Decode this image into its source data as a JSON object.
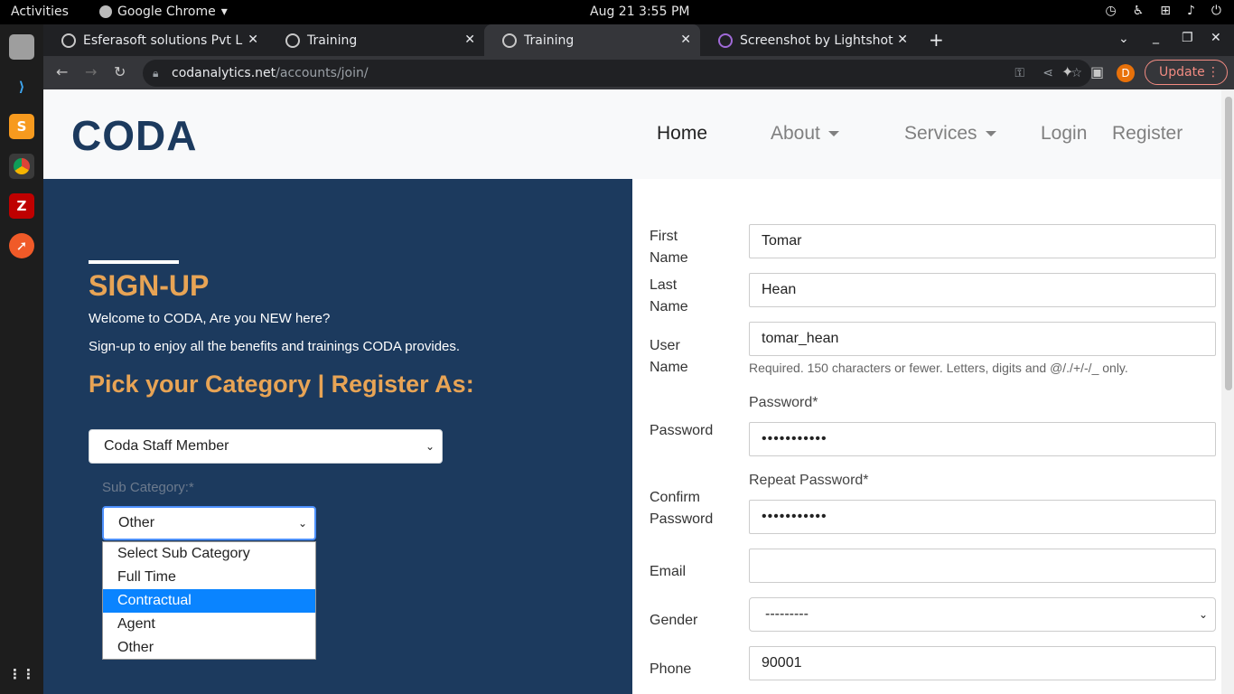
{
  "system": {
    "activities": "Activities",
    "app_name": "Google Chrome",
    "clock": "Aug 21   3:55 PM"
  },
  "browser": {
    "tabs": [
      {
        "label": "Esferasoft solutions Pvt L"
      },
      {
        "label": "Training"
      },
      {
        "label": "Training"
      },
      {
        "label": "Screenshot by Lightshot"
      }
    ],
    "url_host": "codanalytics.net",
    "url_path": "/accounts/join/",
    "profile_initial": "D",
    "update_label": "Update"
  },
  "navbar": {
    "logo": "CODA",
    "items": [
      {
        "label": "Home"
      },
      {
        "label": "About"
      },
      {
        "label": "Services"
      },
      {
        "label": "Login"
      },
      {
        "label": "Register"
      }
    ]
  },
  "left": {
    "title": "SIGN-UP",
    "welcome": "Welcome to CODA, Are you NEW here?",
    "benefits": "Sign-up to enjoy all the benefits and trainings CODA provides.",
    "pick_title": "Pick your Category | Register As:",
    "category_value": "Coda Staff Member",
    "subcategory_label": "Sub Category:*",
    "subcategory_value": "Other",
    "subcategory_options": [
      "Select Sub Category",
      "Full Time",
      "Contractual",
      "Agent",
      "Other"
    ]
  },
  "form": {
    "first_name_label": "First Name",
    "first_name_value": "Tomar",
    "last_name_label": "Last Name",
    "last_name_value": "Hean",
    "username_label": "User Name",
    "username_value": "tomar_hean",
    "username_help": "Required. 150 characters or fewer. Letters, digits and @/./+/-/_ only.",
    "password_heading": "Password*",
    "password_label": "Password",
    "password_value": "•••••••••••",
    "repeat_heading": "Repeat Password*",
    "confirm_label": "Confirm Password",
    "confirm_value": "•••••••••••",
    "email_label": "Email",
    "email_value": "",
    "gender_label": "Gender",
    "gender_value": "---------",
    "phone_label": "Phone",
    "phone_value": "90001"
  },
  "colors": {
    "panel": "#1c3a5e",
    "accent": "#e8a455",
    "highlight": "#0a84ff"
  }
}
